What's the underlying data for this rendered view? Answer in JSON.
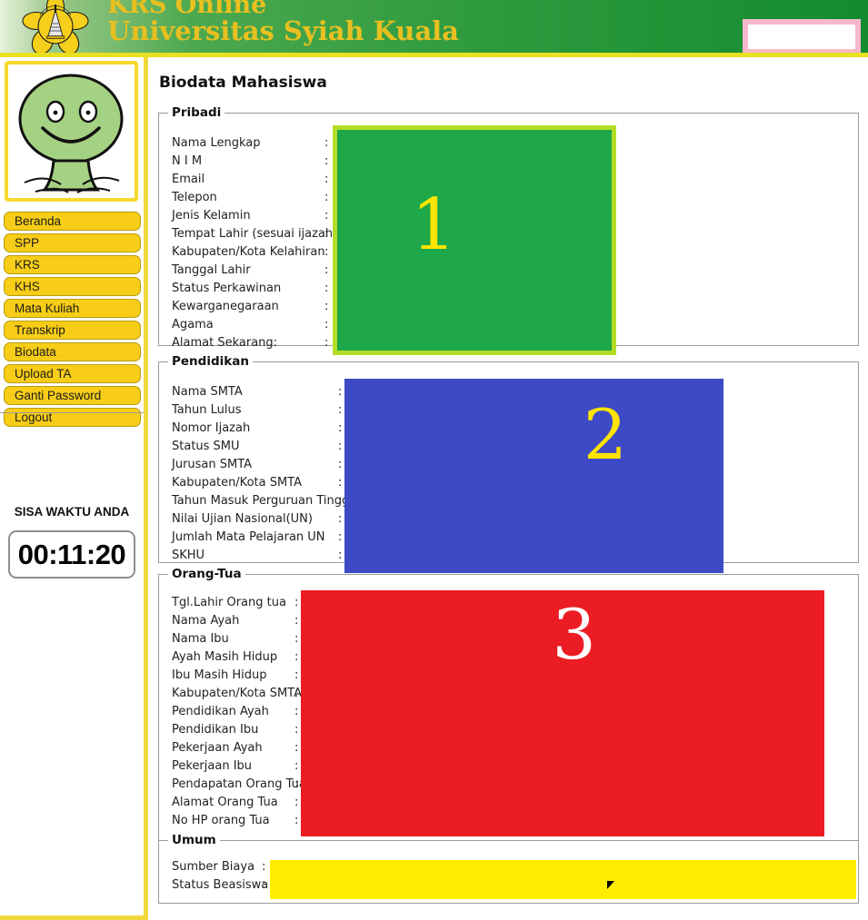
{
  "header": {
    "logo_alt": "university-seal",
    "title_line1": "KRS Online",
    "title_line2": "Universitas Syiah Kuala",
    "top_right_box_value": ""
  },
  "sidebar": {
    "avatar_alt": "student-avatar",
    "menu": [
      {
        "label": "Beranda",
        "active": false
      },
      {
        "label": "SPP",
        "active": false
      },
      {
        "label": "KRS",
        "active": false
      },
      {
        "label": "KHS",
        "active": false
      },
      {
        "label": "Mata Kuliah",
        "active": false
      },
      {
        "label": "Transkrip",
        "active": false
      },
      {
        "label": "Biodata",
        "active": true
      },
      {
        "label": "Upload TA",
        "active": false
      },
      {
        "label": "Ganti Password",
        "active": false
      },
      {
        "label": "Logout",
        "active": false
      }
    ],
    "timer_label": "SISA WAKTU ANDA",
    "timer_value": "00:11:20"
  },
  "main": {
    "page_title": "Biodata Mahasiswa",
    "sections": [
      {
        "legend": "Pribadi",
        "block_number": "1",
        "block_color": "#1fa84a",
        "block_border_color": "#b2dd26",
        "block_number_color": "#ffe400",
        "fields": [
          {
            "label": "Nama Lengkap",
            "sep": ":",
            "value": ""
          },
          {
            "label": "N I M",
            "sep": ":",
            "value": ""
          },
          {
            "label": "Email",
            "sep": ":",
            "value": ""
          },
          {
            "label": "Telepon",
            "sep": ":",
            "value": ""
          },
          {
            "label": "Jenis Kelamin",
            "sep": ":",
            "value": ""
          },
          {
            "label": "Tempat Lahir (sesuai ijazah)",
            "sep": ":",
            "value": ""
          },
          {
            "label": "Kabupaten/Kota Kelahiran",
            "sep": ":",
            "value": ""
          },
          {
            "label": "Tanggal Lahir",
            "sep": ":",
            "value": ""
          },
          {
            "label": "Status Perkawinan",
            "sep": ":",
            "value": ""
          },
          {
            "label": "Kewarganegaraan",
            "sep": ":",
            "value": ""
          },
          {
            "label": "Agama",
            "sep": ":",
            "value": ""
          },
          {
            "label": "Alamat Sekarang:",
            "sep": ":",
            "value": ""
          }
        ]
      },
      {
        "legend": "Pendidikan",
        "block_number": "2",
        "block_color": "#3e49c6",
        "block_number_color": "#ffe400",
        "fields": [
          {
            "label": "Nama SMTA",
            "sep": ":",
            "value": ""
          },
          {
            "label": "Tahun Lulus",
            "sep": ":",
            "value": ""
          },
          {
            "label": "Nomor Ijazah",
            "sep": ":",
            "value": ""
          },
          {
            "label": "Status SMU",
            "sep": ":",
            "value": ""
          },
          {
            "label": "Jurusan SMTA",
            "sep": ":",
            "value": ""
          },
          {
            "label": "Kabupaten/Kota SMTA",
            "sep": ":",
            "value": ""
          },
          {
            "label": "Tahun Masuk Perguruan Tinggi",
            "sep": ":",
            "value": ""
          },
          {
            "label": "Nilai Ujian Nasional(UN)",
            "sep": ":",
            "value": ""
          },
          {
            "label": "Jumlah Mata Pelajaran UN",
            "sep": ":",
            "value": ""
          },
          {
            "label": "SKHU",
            "sep": ":",
            "value": ""
          }
        ]
      },
      {
        "legend": "Orang-Tua",
        "block_number": "3",
        "block_color": "#ec1c24",
        "block_number_color": "#ffffff",
        "fields": [
          {
            "label": "Tgl.Lahir Orang tua",
            "sep": ":",
            "value": ""
          },
          {
            "label": "Nama Ayah",
            "sep": ":",
            "value": ""
          },
          {
            "label": "Nama Ibu",
            "sep": ":",
            "value": ""
          },
          {
            "label": "Ayah Masih Hidup",
            "sep": ":",
            "value": ""
          },
          {
            "label": "Ibu Masih Hidup",
            "sep": ":",
            "value": ""
          },
          {
            "label": "Kabupaten/Kota SMTA",
            "sep": ":",
            "value": ""
          },
          {
            "label": "Pendidikan Ayah",
            "sep": ":",
            "value": ""
          },
          {
            "label": "Pendidikan Ibu",
            "sep": ":",
            "value": ""
          },
          {
            "label": "Pekerjaan Ayah",
            "sep": ":",
            "value": ""
          },
          {
            "label": "Pekerjaan Ibu",
            "sep": ":",
            "value": ""
          },
          {
            "label": "Pendapatan Orang Tua",
            "sep": ":",
            "value": ""
          },
          {
            "label": "Alamat Orang Tua",
            "sep": ":",
            "value": ""
          },
          {
            "label": "No HP orang Tua",
            "sep": ":",
            "value": ""
          }
        ]
      },
      {
        "legend": "Umum",
        "block_number": "",
        "block_color": "#ffed00",
        "fields": [
          {
            "label": "Sumber Biaya",
            "sep": ":",
            "value": ""
          },
          {
            "label": "Status Beasiswa",
            "sep": ":",
            "value": ""
          }
        ]
      }
    ]
  },
  "colors": {
    "brand_yellow": "#e8c020",
    "header_green_light": "#4ca84f",
    "header_green_dark": "#128c2e",
    "menu_yellow": "#f7cd17",
    "divider_yellow": "#f0d83c",
    "pink_border": "#f7b8cc"
  }
}
